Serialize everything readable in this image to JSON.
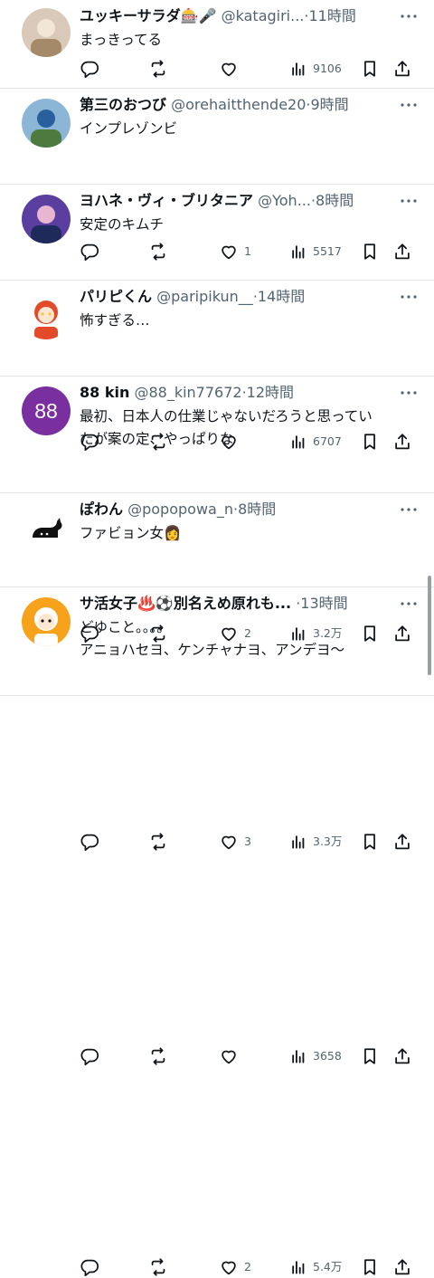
{
  "tweets": [
    {
      "name": "ユッキーサラダ🎰🎤",
      "handle": "@katagiri...",
      "dot": "·",
      "time": "11時間",
      "lines": [
        "まっきってる"
      ],
      "likes": "",
      "views": "9106",
      "avatar": {
        "type": "photo",
        "colors": [
          "#d9c9b8",
          "#a58a6a",
          "#f2e6d6"
        ]
      }
    },
    {
      "name": "第三のおつび",
      "handle": "@orehaitthende20",
      "dot": "·",
      "time": "9時間",
      "lines": [
        "インプレゾンビ"
      ],
      "likes": "1",
      "views": "5517",
      "avatar": {
        "type": "photo",
        "colors": [
          "#8cb6d6",
          "#4d7a3e",
          "#2a5f9e"
        ]
      }
    },
    {
      "name": "ヨハネ・ヴィ・ブリタニア",
      "handle": "@Yoh...",
      "dot": "·",
      "time": "8時間",
      "lines": [
        "安定のキムチ"
      ],
      "likes": "",
      "views": "6707",
      "avatar": {
        "type": "photo",
        "colors": [
          "#5b3fa0",
          "#1e2a5a",
          "#e8b6d0"
        ]
      }
    },
    {
      "name": "パリピくん",
      "handle": "@paripikun__",
      "dot": "·",
      "time": "14時間",
      "lines": [
        "怖すぎる…"
      ],
      "likes": "2",
      "views": "3.2万",
      "avatar": {
        "type": "illustration",
        "colors": [
          "#ffffff",
          "#e24a2a",
          "#f5c542"
        ]
      }
    },
    {
      "name": "88 kin",
      "handle": "@88_kin77672",
      "dot": "·",
      "time": "12時間",
      "lines": [
        "最初、日本人の仕業じゃないだろうと思ってい",
        "たが案の定、やっぱりな"
      ],
      "likes": "3",
      "views": "3.3万",
      "avatar": {
        "type": "initials",
        "text": "88",
        "colors": [
          "#7a2fa0",
          "#ffffff"
        ]
      }
    },
    {
      "name": "ぽわん",
      "handle": "@popopowa_n",
      "dot": "·",
      "time": "8時間",
      "lines": [
        "ファビョン女👩"
      ],
      "likes": "",
      "views": "3658",
      "avatar": {
        "type": "cat",
        "colors": [
          "#ffffff",
          "#111111"
        ]
      }
    },
    {
      "name": "サ活女子♨️⚽別名えめ原れも...",
      "handle": "",
      "dot": "·",
      "time": "13時間",
      "lines": [
        "どゆこと。。。。",
        "アニョハセヨ、ケンチャナヨ、アンデヨ〜"
      ],
      "likes": "2",
      "views": "5.4万",
      "avatar": {
        "type": "illustration",
        "colors": [
          "#f7a21b",
          "#ffffff",
          "#111111"
        ]
      }
    }
  ],
  "ui": {
    "accent": "#0f1419",
    "muted": "#536471",
    "divider": "#e3e6e9",
    "icons": [
      "reply-icon",
      "retweet-icon",
      "like-icon",
      "views-icon",
      "bookmark-icon",
      "share-icon",
      "more-icon"
    ]
  }
}
